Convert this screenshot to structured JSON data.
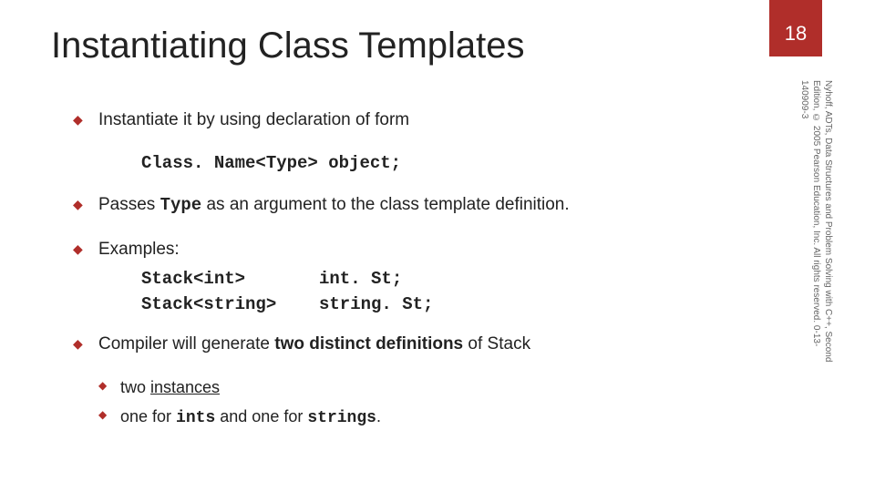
{
  "pageNumber": "18",
  "title": "Instantiating Class Templates",
  "copyright": "Nyhoff, ADTs, Data Structures and Problem Solving with C++, Second Edition, © 2005 Pearson Education, Inc. All rights reserved. 0-13-140909-3",
  "bullets": {
    "b1": "Instantiate it by using declaration of form",
    "code1": "Class. Name<Type> object;",
    "b2_pre": "Passes ",
    "b2_code": "Type",
    "b2_post": " as an argument to the class template definition.",
    "b3": "Examples:",
    "ex1_l": "Stack<int>",
    "ex1_r": "int. St;",
    "ex2_l": "Stack<string>",
    "ex2_r": "string. St;",
    "b4_pre": "Compiler will generate ",
    "b4_bold": "two distinct definitions",
    "b4_post": " of Stack",
    "sub1_pre": "two ",
    "sub1_u": "instances",
    "sub2_pre": "one for ",
    "sub2_c1": "ints",
    "sub2_mid": " and one for ",
    "sub2_c2": "strings",
    "sub2_post": "."
  }
}
